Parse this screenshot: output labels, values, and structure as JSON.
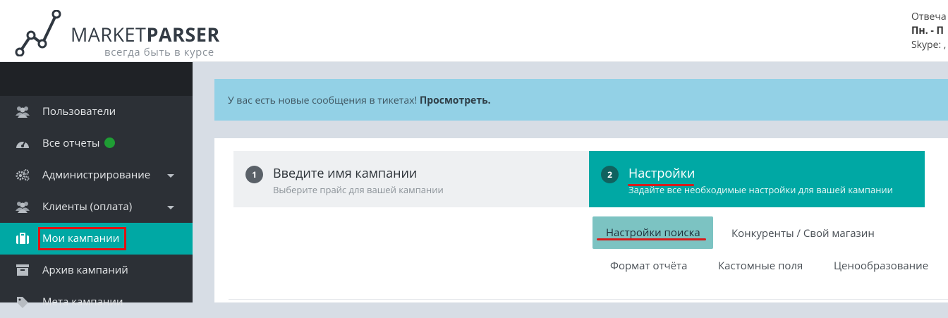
{
  "brand": {
    "name_part1": "MARKET",
    "name_part2": "PARSER",
    "tagline": "всегда быть в курсе"
  },
  "contacts": {
    "line1": "Отвеча",
    "line2": "Пн. - П",
    "line3": "Skype: ,"
  },
  "sidebar": {
    "items": [
      {
        "label": "Пользователи",
        "icon": "users-icon"
      },
      {
        "label": "Все отчеты",
        "icon": "dashboard-icon"
      },
      {
        "label": "Администрирование",
        "icon": "cogs-icon"
      },
      {
        "label": "Клиенты (оплата)",
        "icon": "users-icon"
      },
      {
        "label": "Мои кампании",
        "icon": "briefcase-icon"
      },
      {
        "label": "Архив кампаний",
        "icon": "archive-icon"
      },
      {
        "label": "Мета кампании",
        "icon": "tags-icon"
      }
    ]
  },
  "alert": {
    "text": "У вас есть новые сообщения в тикетах! ",
    "link": "Просмотреть."
  },
  "steps": [
    {
      "number": "1",
      "title": "Введите имя кампании",
      "subtitle": "Выберите прайс для вашей кампании"
    },
    {
      "number": "2",
      "title": "Настройки",
      "subtitle": "Задайте все необходимые настройки для вашей кампании"
    }
  ],
  "tabs": {
    "search_settings": "Настройки поиска",
    "competitors": "Конкуренты / Свой магазин",
    "report_format": "Формат отчёта",
    "custom_fields": "Кастомные поля",
    "pricing": "Ценообразование"
  },
  "colors": {
    "accent": "#00a8a4",
    "sidebar": "#2c3036",
    "alert": "#93d1e6",
    "annotation": "#e01212"
  }
}
